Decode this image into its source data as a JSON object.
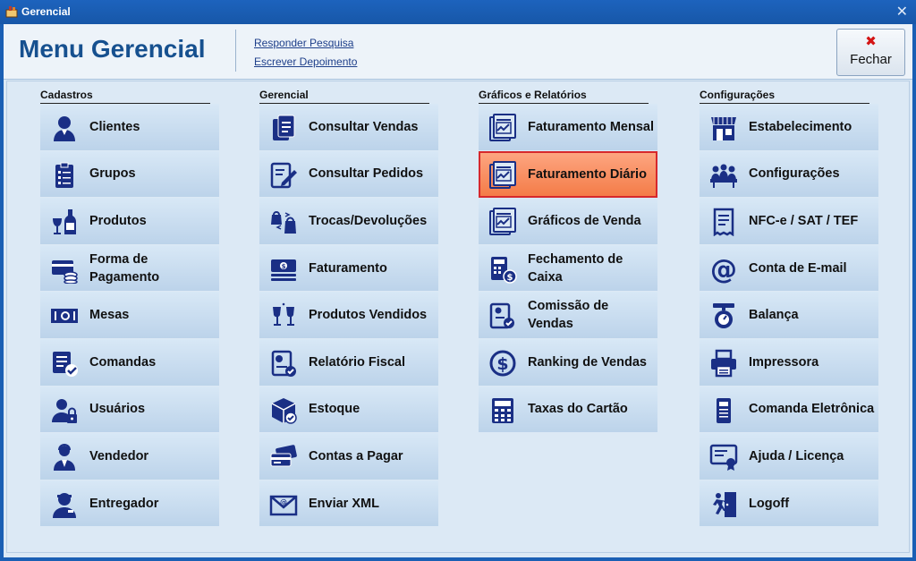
{
  "window": {
    "title": "Gerencial",
    "close_glyph": "✕"
  },
  "header": {
    "title": "Menu Gerencial",
    "links": [
      "Responder Pesquisa",
      "Escrever Depoimento"
    ],
    "close_button": {
      "icon": "close-x-icon",
      "label": "Fechar"
    }
  },
  "columns": [
    {
      "title": "Cadastros",
      "items": [
        {
          "label": "Clientes",
          "icon": "user-icon"
        },
        {
          "label": "Grupos",
          "icon": "clipboard-list-icon"
        },
        {
          "label": "Produtos",
          "icon": "wine-bottle-icon"
        },
        {
          "label": "Forma de Pagamento",
          "icon": "card-coins-icon"
        },
        {
          "label": "Mesas",
          "icon": "table-dinner-icon"
        },
        {
          "label": "Comandas",
          "icon": "checklist-icon"
        },
        {
          "label": "Usuários",
          "icon": "user-lock-icon"
        },
        {
          "label": "Vendedor",
          "icon": "seller-icon"
        },
        {
          "label": "Entregador",
          "icon": "delivery-man-icon"
        }
      ]
    },
    {
      "title": "Gerencial",
      "items": [
        {
          "label": "Consultar Vendas",
          "icon": "documents-icon"
        },
        {
          "label": "Consultar Pedidos",
          "icon": "edit-document-icon"
        },
        {
          "label": "Trocas/Devoluções",
          "icon": "exchange-bags-icon"
        },
        {
          "label": "Faturamento",
          "icon": "cash-stack-icon"
        },
        {
          "label": "Produtos Vendidos",
          "icon": "toast-glasses-icon"
        },
        {
          "label": "Relatório Fiscal",
          "icon": "fiscal-report-icon"
        },
        {
          "label": "Estoque",
          "icon": "boxes-icon"
        },
        {
          "label": "Contas a Pagar",
          "icon": "credit-cards-icon"
        },
        {
          "label": "Enviar XML",
          "icon": "email-envelope-icon"
        }
      ]
    },
    {
      "title": "Gráficos e Relatórios",
      "items": [
        {
          "label": "Faturamento Mensal",
          "icon": "chart-doc-icon"
        },
        {
          "label": "Faturamento Diário",
          "icon": "chart-doc-icon",
          "selected": true
        },
        {
          "label": "Gráficos de Venda",
          "icon": "chart-doc-icon"
        },
        {
          "label": "Fechamento de Caixa",
          "icon": "calculator-coin-icon"
        },
        {
          "label": "Comissão de Vendas",
          "icon": "commission-report-icon"
        },
        {
          "label": "Ranking de Vendas",
          "icon": "dollar-circle-icon"
        },
        {
          "label": "Taxas do Cartão",
          "icon": "calculator-icon"
        }
      ]
    },
    {
      "title": "Configurações",
      "items": [
        {
          "label": "Estabelecimento",
          "icon": "store-icon"
        },
        {
          "label": "Configurações",
          "icon": "people-desk-icon"
        },
        {
          "label": "NFC-e / SAT / TEF",
          "icon": "receipt-icon"
        },
        {
          "label": "Conta de E-mail",
          "icon": "at-sign-icon"
        },
        {
          "label": "Balança",
          "icon": "scale-icon"
        },
        {
          "label": "Impressora",
          "icon": "printer-icon"
        },
        {
          "label": "Comanda Eletrônica",
          "icon": "handheld-device-icon"
        },
        {
          "label": "Ajuda / Licença",
          "icon": "certificate-icon"
        },
        {
          "label": "Logoff",
          "icon": "exit-door-icon"
        }
      ]
    }
  ],
  "colors": {
    "icon": "#1a2f85",
    "selected_bg": "#f6895a",
    "selected_border": "#d6282c"
  }
}
